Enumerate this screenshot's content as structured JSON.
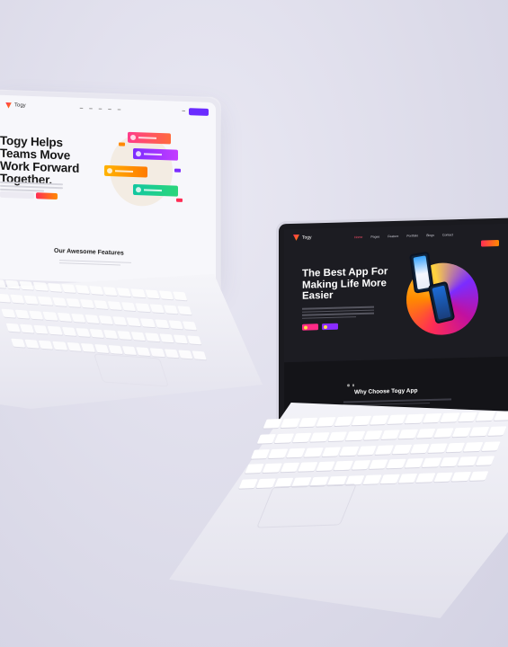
{
  "left_laptop": {
    "logo": "Togy",
    "headline": "Togy Helps Teams Move Work Forward Together.",
    "section_title": "Our Awesome Features"
  },
  "right_laptop": {
    "logo": "Togy",
    "nav_links": [
      "Home",
      "Pages",
      "Feature",
      "Portfolio",
      "Blogs",
      "Contact"
    ],
    "headline": "The Best App For Making Life More Easier",
    "section_title": "Why Choose Togy App"
  },
  "colors": {
    "background": "#dcdbe9",
    "accent_pink": "#ff2d55",
    "accent_orange": "#ff8a00",
    "accent_purple": "#8a2bff",
    "dark_screen": "#1c1c22"
  }
}
